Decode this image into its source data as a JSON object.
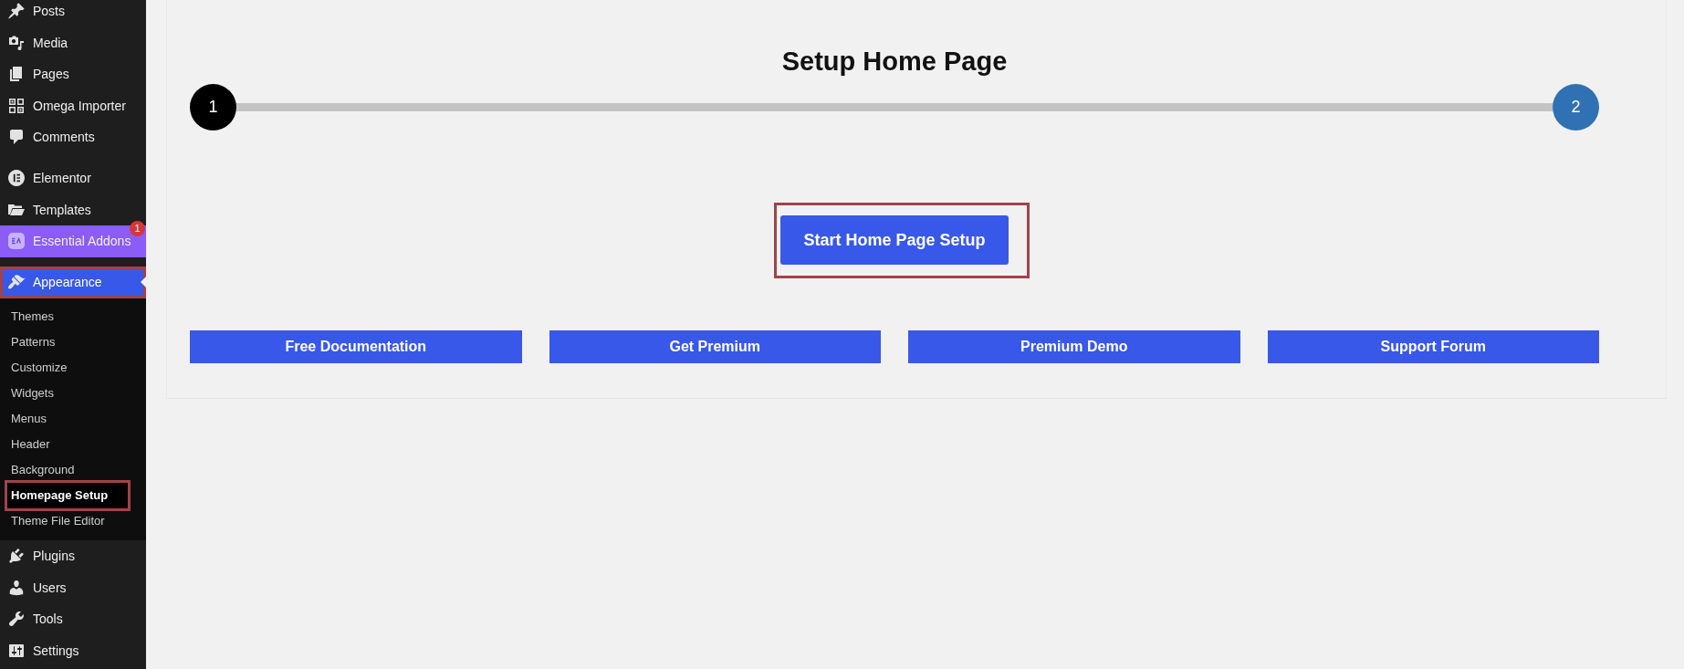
{
  "sidebar": {
    "groups": [
      {
        "items": [
          {
            "label": "Posts",
            "selected": false,
            "accent": false,
            "highlighted": false
          },
          {
            "label": "Media",
            "selected": false,
            "accent": false,
            "highlighted": false
          },
          {
            "label": "Pages",
            "selected": false,
            "accent": false,
            "highlighted": false
          },
          {
            "label": "Omega Importer",
            "selected": false,
            "accent": false,
            "highlighted": false
          },
          {
            "label": "Comments",
            "selected": false,
            "accent": false,
            "highlighted": false
          }
        ]
      },
      {
        "items": [
          {
            "label": "Elementor",
            "selected": false,
            "accent": false,
            "highlighted": false
          },
          {
            "label": "Templates",
            "selected": false,
            "accent": false,
            "highlighted": false
          },
          {
            "label": "Essential Addons",
            "selected": false,
            "accent": true,
            "highlighted": false,
            "badge": "1"
          }
        ]
      },
      {
        "items": [
          {
            "label": "Appearance",
            "selected": true,
            "accent": false,
            "highlighted": true,
            "children": [
              {
                "label": "Themes",
                "selected": false,
                "highlighted": false
              },
              {
                "label": "Patterns",
                "selected": false,
                "highlighted": false
              },
              {
                "label": "Customize",
                "selected": false,
                "highlighted": false
              },
              {
                "label": "Widgets",
                "selected": false,
                "highlighted": false
              },
              {
                "label": "Menus",
                "selected": false,
                "highlighted": false
              },
              {
                "label": "Header",
                "selected": false,
                "highlighted": false
              },
              {
                "label": "Background",
                "selected": false,
                "highlighted": false
              },
              {
                "label": "Homepage Setup",
                "selected": true,
                "highlighted": true
              },
              {
                "label": "Theme File Editor",
                "selected": false,
                "highlighted": false
              }
            ]
          },
          {
            "label": "Plugins",
            "selected": false,
            "accent": false,
            "highlighted": false
          },
          {
            "label": "Users",
            "selected": false,
            "accent": false,
            "highlighted": false
          },
          {
            "label": "Tools",
            "selected": false,
            "accent": false,
            "highlighted": false
          },
          {
            "label": "Settings",
            "selected": false,
            "accent": false,
            "highlighted": false
          }
        ]
      }
    ]
  },
  "page": {
    "title": "Setup Home Page",
    "steps": [
      {
        "label": "1",
        "color": "#000000"
      },
      {
        "label": "2",
        "color": "#3071b3"
      }
    ],
    "start_button": {
      "label": "Start Home Page Setup",
      "highlighted": true
    },
    "links": [
      "Free Documentation",
      "Get Premium",
      "Premium Demo",
      "Support Forum"
    ]
  }
}
